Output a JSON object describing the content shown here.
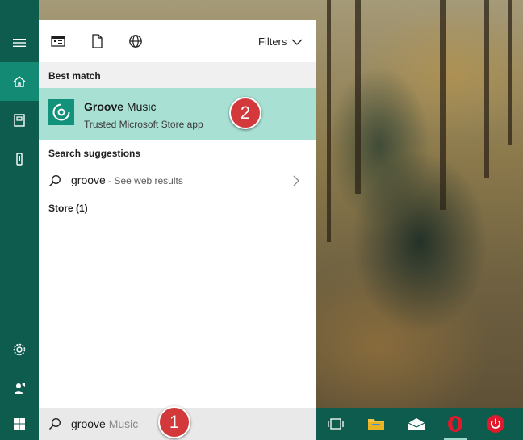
{
  "toolbar": {
    "apps_icon": "apps-filter-icon",
    "documents_icon": "document-filter-icon",
    "web_icon": "web-filter-icon",
    "filters_label": "Filters"
  },
  "rail": {
    "items": [
      "hamburger-menu-icon",
      "home-icon",
      "notebook-icon",
      "devices-icon",
      "settings-icon",
      "feedback-icon",
      "windows-start-icon"
    ]
  },
  "best_match": {
    "header": "Best match",
    "app_name_bold": "Groove",
    "app_name_rest": " Music",
    "app_subtitle": "Trusted Microsoft Store app",
    "callout_number": "2"
  },
  "suggestions": {
    "header": "Search suggestions",
    "term": "groove",
    "hint": " - See web results"
  },
  "store": {
    "header": "Store (1)"
  },
  "search": {
    "typed": "groove",
    "autocomplete": " Music",
    "callout_number": "1"
  },
  "taskbar": {
    "items": [
      "task-view-icon",
      "file-explorer-icon",
      "mail-icon",
      "opera-icon",
      "power-icon"
    ]
  },
  "colors": {
    "accent": "#0d5c4e",
    "highlight": "#a8e0d4",
    "callout": "#d3383a"
  }
}
